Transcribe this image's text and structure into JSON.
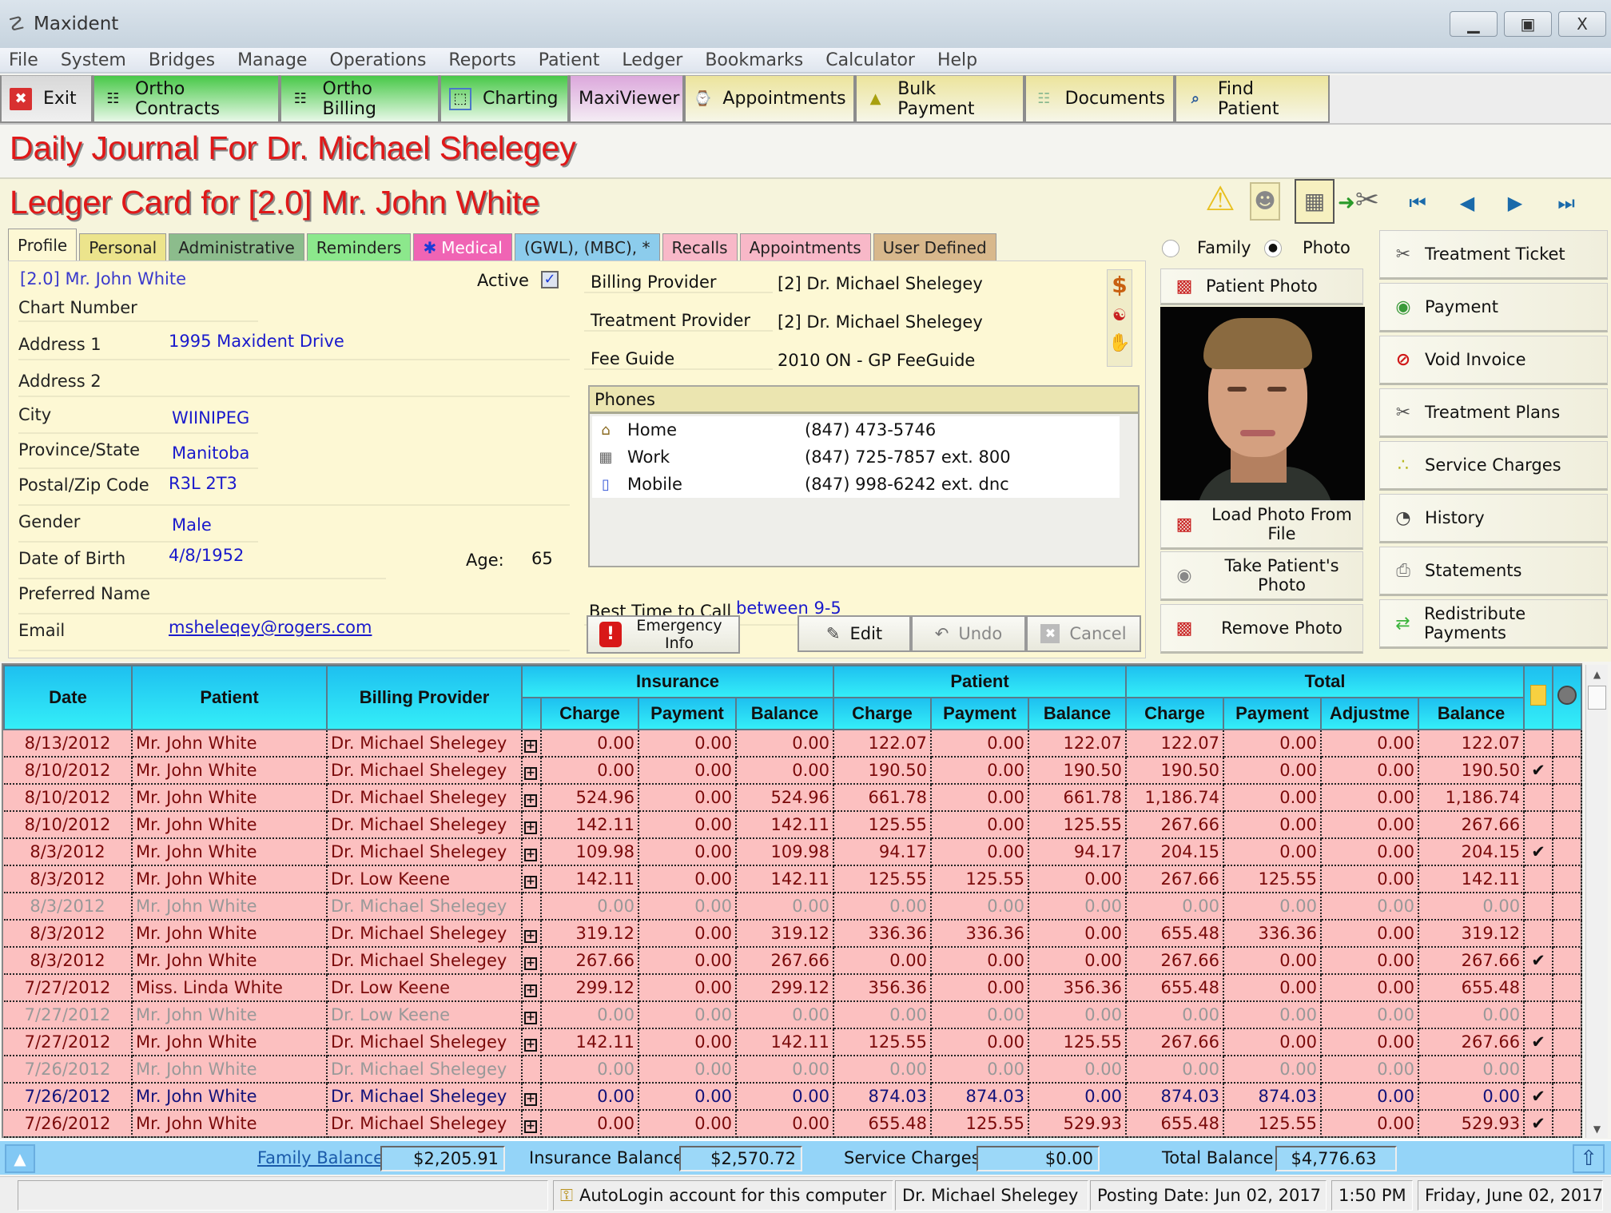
{
  "app": {
    "title": "Maxident",
    "window_controls": {
      "minimize": "▁",
      "maximize": "▣",
      "close": "X"
    }
  },
  "menu": [
    "File",
    "System",
    "Bridges",
    "Manage",
    "Operations",
    "Reports",
    "Patient",
    "Ledger",
    "Bookmarks",
    "Calculator",
    "Help"
  ],
  "toolbar": [
    {
      "label": "Exit",
      "icon": "exit-icon",
      "glyph": "✖",
      "style": "gray"
    },
    {
      "label": "Ortho Contracts",
      "icon": "abacus-icon",
      "glyph": "☷",
      "style": "green"
    },
    {
      "label": "Ortho Billing",
      "icon": "abacus-icon",
      "glyph": "☷",
      "style": "green"
    },
    {
      "label": "Charting",
      "icon": "tooth-chart-icon",
      "glyph": "⬚",
      "style": "green"
    },
    {
      "label": "MaxiViewer",
      "icon": "",
      "glyph": "",
      "style": "pink"
    },
    {
      "label": "Appointments",
      "icon": "clock-calendar-icon",
      "glyph": "⌚",
      "style": "yellow"
    },
    {
      "label": "Bulk Payment",
      "icon": "money-bag-icon",
      "glyph": "▲",
      "style": "yellow"
    },
    {
      "label": "Documents",
      "icon": "documents-icon",
      "glyph": "☷",
      "style": "yellow"
    },
    {
      "label": "Find Patient",
      "icon": "find-patient-icon",
      "glyph": "⌕",
      "style": "yellow"
    }
  ],
  "journal_title": "Daily Journal For Dr. Michael Shelegey",
  "ledger_title": "Ledger Card for [2.0] Mr. John White",
  "tabs": [
    {
      "label": "Profile",
      "color": "#fdf8d4",
      "active": true
    },
    {
      "label": "Personal",
      "color": "#ece48c"
    },
    {
      "label": "Administrative",
      "color": "#8cbc8c"
    },
    {
      "label": "Reminders",
      "color": "#8ce88c"
    },
    {
      "label": "Medical",
      "color": "#f064b4",
      "text_color": "#ffffff"
    },
    {
      "label": "(GWL), (MBC), *",
      "color": "#8cccec"
    },
    {
      "label": "Recalls",
      "color": "#f8b8c8"
    },
    {
      "label": "Appointments",
      "color": "#f8b8c8"
    },
    {
      "label": "User Defined",
      "color": "#d8b88c"
    }
  ],
  "profile": {
    "patient_name": "[2.0] Mr. John White",
    "active_label": "Active",
    "active_checked": true,
    "fields": [
      {
        "label": "Chart Number",
        "value": ""
      },
      {
        "label": "Address 1",
        "value": "1995 Maxident Drive"
      },
      {
        "label": "Address 2",
        "value": ""
      },
      {
        "label": "City",
        "value": "WIINIPEG"
      },
      {
        "label": "Province/State",
        "value": "Manitoba"
      },
      {
        "label": "Postal/Zip Code",
        "value": "R3L 2T3"
      },
      {
        "label": "Gender",
        "value": "Male"
      },
      {
        "label": "Date of Birth",
        "value": "4/8/1952"
      },
      {
        "label": "Preferred Name",
        "value": ""
      },
      {
        "label": "Email",
        "value": "msheleqey@rogers.com"
      }
    ],
    "age_label": "Age:",
    "age_value": "65",
    "billing_provider_label": "Billing Provider",
    "billing_provider_value": "[2] Dr. Michael Shelegey",
    "treatment_provider_label": "Treatment Provider",
    "treatment_provider_value": "[2] Dr. Michael Shelegey",
    "fee_guide_label": "Fee Guide",
    "fee_guide_value": "2010 ON - GP FeeGuide",
    "phones_title": "Phones",
    "phones": [
      {
        "type": "Home",
        "number": "(847) 473-5746",
        "icon": "house-icon"
      },
      {
        "type": "Work",
        "number": "(847) 725-7857 ext. 800",
        "icon": "building-icon"
      },
      {
        "type": "Mobile",
        "number": "(847) 998-6242 ext. dnc",
        "icon": "mobile-phone-icon"
      }
    ],
    "best_time_label": "Best Time to Call",
    "best_time_value": "between 9-5",
    "emergency_label": "Emergency Info",
    "edit_label": "Edit",
    "undo_label": "Undo",
    "cancel_label": "Cancel"
  },
  "view_toggle": {
    "family_label": "Family",
    "photo_label": "Photo",
    "selected": "Photo"
  },
  "photo_panel": {
    "header_label": "Patient Photo",
    "load_label": "Load Photo From File",
    "take_label": "Take Patient's Photo",
    "remove_label": "Remove Photo"
  },
  "side_actions": [
    {
      "label": "Treatment Ticket",
      "icon": "dental-tools-icon",
      "glyph": "✂"
    },
    {
      "label": "Payment",
      "icon": "money-icon",
      "glyph": "◉",
      "color": "#3a9a3a"
    },
    {
      "label": "Void Invoice",
      "icon": "no-entry-icon",
      "glyph": "⊘",
      "color": "#d01818"
    },
    {
      "label": "Treatment Plans",
      "icon": "treatment-plan-icon",
      "glyph": "✂"
    },
    {
      "label": "Service Charges",
      "icon": "service-charges-icon",
      "glyph": "∴",
      "color": "#b8b820"
    },
    {
      "label": "History",
      "icon": "history-clock-icon",
      "glyph": "◔"
    },
    {
      "label": "Statements",
      "icon": "printer-icon",
      "glyph": "⎙",
      "color": "#777"
    },
    {
      "label": "Redistribute Payments",
      "icon": "redistribute-arrows-icon",
      "glyph": "⇄",
      "color": "#3cb43c"
    }
  ],
  "grid": {
    "headers": {
      "date": "Date",
      "patient": "Patient",
      "billing_provider": "Billing Provider",
      "insurance": "Insurance",
      "patient_group": "Patient",
      "total": "Total",
      "charge": "Charge",
      "payment": "Payment",
      "balance": "Balance",
      "adjustment": "Adjustme"
    },
    "rows": [
      {
        "date": "8/13/2012",
        "patient": "Mr. John White",
        "provider": "Dr. Michael Shelegey",
        "expand": true,
        "ins": [
          "0.00",
          "0.00",
          "0.00"
        ],
        "pat": [
          "122.07",
          "0.00",
          "122.07"
        ],
        "tot": [
          "122.07",
          "0.00",
          "0.00",
          "122.07"
        ],
        "check": false,
        "style": "normal"
      },
      {
        "date": "8/10/2012",
        "patient": "Mr. John White",
        "provider": "Dr. Michael Shelegey",
        "expand": true,
        "ins": [
          "0.00",
          "0.00",
          "0.00"
        ],
        "pat": [
          "190.50",
          "0.00",
          "190.50"
        ],
        "tot": [
          "190.50",
          "0.00",
          "0.00",
          "190.50"
        ],
        "check": true,
        "style": "normal"
      },
      {
        "date": "8/10/2012",
        "patient": "Mr. John White",
        "provider": "Dr. Michael Shelegey",
        "expand": true,
        "ins": [
          "524.96",
          "0.00",
          "524.96"
        ],
        "pat": [
          "661.78",
          "0.00",
          "661.78"
        ],
        "tot": [
          "1,186.74",
          "0.00",
          "0.00",
          "1,186.74"
        ],
        "check": false,
        "style": "normal"
      },
      {
        "date": "8/10/2012",
        "patient": "Mr. John White",
        "provider": "Dr. Michael Shelegey",
        "expand": true,
        "ins": [
          "142.11",
          "0.00",
          "142.11"
        ],
        "pat": [
          "125.55",
          "0.00",
          "125.55"
        ],
        "tot": [
          "267.66",
          "0.00",
          "0.00",
          "267.66"
        ],
        "check": false,
        "style": "normal"
      },
      {
        "date": "8/3/2012",
        "patient": "Mr. John White",
        "provider": "Dr. Michael Shelegey",
        "expand": true,
        "ins": [
          "109.98",
          "0.00",
          "109.98"
        ],
        "pat": [
          "94.17",
          "0.00",
          "94.17"
        ],
        "tot": [
          "204.15",
          "0.00",
          "0.00",
          "204.15"
        ],
        "check": true,
        "style": "normal"
      },
      {
        "date": "8/3/2012",
        "patient": "Mr. John White",
        "provider": "Dr. Low Keene",
        "expand": true,
        "ins": [
          "142.11",
          "0.00",
          "142.11"
        ],
        "pat": [
          "125.55",
          "125.55",
          "0.00"
        ],
        "tot": [
          "267.66",
          "125.55",
          "0.00",
          "142.11"
        ],
        "check": false,
        "style": "normal"
      },
      {
        "date": "8/3/2012",
        "patient": "Mr. John White",
        "provider": "Dr. Michael Shelegey",
        "expand": false,
        "ins": [
          "0.00",
          "0.00",
          "0.00"
        ],
        "pat": [
          "0.00",
          "0.00",
          "0.00"
        ],
        "tot": [
          "0.00",
          "0.00",
          "0.00",
          "0.00"
        ],
        "check": false,
        "style": "dim"
      },
      {
        "date": "8/3/2012",
        "patient": "Mr. John White",
        "provider": "Dr. Michael Shelegey",
        "expand": true,
        "ins": [
          "319.12",
          "0.00",
          "319.12"
        ],
        "pat": [
          "336.36",
          "336.36",
          "0.00"
        ],
        "tot": [
          "655.48",
          "336.36",
          "0.00",
          "319.12"
        ],
        "check": false,
        "style": "normal"
      },
      {
        "date": "8/3/2012",
        "patient": "Mr. John White",
        "provider": "Dr. Michael Shelegey",
        "expand": true,
        "ins": [
          "267.66",
          "0.00",
          "267.66"
        ],
        "pat": [
          "0.00",
          "0.00",
          "0.00"
        ],
        "tot": [
          "267.66",
          "0.00",
          "0.00",
          "267.66"
        ],
        "check": true,
        "style": "normal"
      },
      {
        "date": "7/27/2012",
        "patient": "Miss. Linda White",
        "provider": "Dr. Low Keene",
        "expand": true,
        "ins": [
          "299.12",
          "0.00",
          "299.12"
        ],
        "pat": [
          "356.36",
          "0.00",
          "356.36"
        ],
        "tot": [
          "655.48",
          "0.00",
          "0.00",
          "655.48"
        ],
        "check": false,
        "style": "normal"
      },
      {
        "date": "7/27/2012",
        "patient": "Mr. John White",
        "provider": "Dr. Low Keene",
        "expand": true,
        "ins": [
          "0.00",
          "0.00",
          "0.00"
        ],
        "pat": [
          "0.00",
          "0.00",
          "0.00"
        ],
        "tot": [
          "0.00",
          "0.00",
          "0.00",
          "0.00"
        ],
        "check": false,
        "style": "dim"
      },
      {
        "date": "7/27/2012",
        "patient": "Mr. John White",
        "provider": "Dr. Michael Shelegey",
        "expand": true,
        "ins": [
          "142.11",
          "0.00",
          "142.11"
        ],
        "pat": [
          "125.55",
          "0.00",
          "125.55"
        ],
        "tot": [
          "267.66",
          "0.00",
          "0.00",
          "267.66"
        ],
        "check": true,
        "style": "normal"
      },
      {
        "date": "7/26/2012",
        "patient": "Mr. John White",
        "provider": "Dr. Michael Shelegey",
        "expand": false,
        "ins": [
          "0.00",
          "0.00",
          "0.00"
        ],
        "pat": [
          "0.00",
          "0.00",
          "0.00"
        ],
        "tot": [
          "0.00",
          "0.00",
          "0.00",
          "0.00"
        ],
        "check": false,
        "style": "dim"
      },
      {
        "date": "7/26/2012",
        "patient": "Mr. John White",
        "provider": "Dr. Michael Shelegey",
        "expand": true,
        "ins": [
          "0.00",
          "0.00",
          "0.00"
        ],
        "pat": [
          "874.03",
          "874.03",
          "0.00"
        ],
        "tot": [
          "874.03",
          "874.03",
          "0.00",
          "0.00"
        ],
        "check": true,
        "style": "blue"
      },
      {
        "date": "7/26/2012",
        "patient": "Mr. John White",
        "provider": "Dr. Michael Shelegey",
        "expand": true,
        "ins": [
          "0.00",
          "0.00",
          "0.00"
        ],
        "pat": [
          "655.48",
          "125.55",
          "529.93"
        ],
        "tot": [
          "655.48",
          "125.55",
          "0.00",
          "529.93"
        ],
        "check": true,
        "style": "normal"
      }
    ]
  },
  "footer": {
    "family_balance_label": "Family Balance",
    "family_balance": "$2,205.91",
    "insurance_balance_label": "Insurance Balance",
    "insurance_balance": "$2,570.72",
    "service_charges_label": "Service Charges",
    "service_charges": "$0.00",
    "total_balance_label": "Total Balance",
    "total_balance": "$4,776.63"
  },
  "statusbar": {
    "autologin": "AutoLogin account for this computer",
    "provider": "Dr. Michael Shelegey",
    "posting_date": "Posting Date: Jun 02, 2017",
    "time": "1:50 PM",
    "date": "Friday, June 02, 2017"
  },
  "colors": {
    "title_red": "#e01818",
    "grid_row": "#fcc0c0",
    "grid_header": "#22d0f4",
    "footer": "#94d4f8"
  }
}
